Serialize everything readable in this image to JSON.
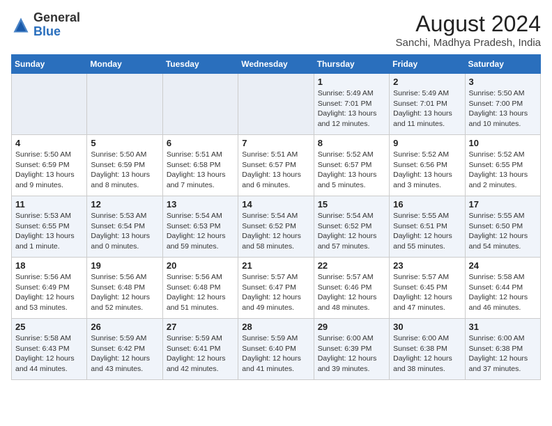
{
  "header": {
    "logo_general": "General",
    "logo_blue": "Blue",
    "month_year": "August 2024",
    "location": "Sanchi, Madhya Pradesh, India"
  },
  "weekdays": [
    "Sunday",
    "Monday",
    "Tuesday",
    "Wednesday",
    "Thursday",
    "Friday",
    "Saturday"
  ],
  "weeks": [
    [
      {
        "day": "",
        "info": ""
      },
      {
        "day": "",
        "info": ""
      },
      {
        "day": "",
        "info": ""
      },
      {
        "day": "",
        "info": ""
      },
      {
        "day": "1",
        "info": "Sunrise: 5:49 AM\nSunset: 7:01 PM\nDaylight: 13 hours\nand 12 minutes."
      },
      {
        "day": "2",
        "info": "Sunrise: 5:49 AM\nSunset: 7:01 PM\nDaylight: 13 hours\nand 11 minutes."
      },
      {
        "day": "3",
        "info": "Sunrise: 5:50 AM\nSunset: 7:00 PM\nDaylight: 13 hours\nand 10 minutes."
      }
    ],
    [
      {
        "day": "4",
        "info": "Sunrise: 5:50 AM\nSunset: 6:59 PM\nDaylight: 13 hours\nand 9 minutes."
      },
      {
        "day": "5",
        "info": "Sunrise: 5:50 AM\nSunset: 6:59 PM\nDaylight: 13 hours\nand 8 minutes."
      },
      {
        "day": "6",
        "info": "Sunrise: 5:51 AM\nSunset: 6:58 PM\nDaylight: 13 hours\nand 7 minutes."
      },
      {
        "day": "7",
        "info": "Sunrise: 5:51 AM\nSunset: 6:57 PM\nDaylight: 13 hours\nand 6 minutes."
      },
      {
        "day": "8",
        "info": "Sunrise: 5:52 AM\nSunset: 6:57 PM\nDaylight: 13 hours\nand 5 minutes."
      },
      {
        "day": "9",
        "info": "Sunrise: 5:52 AM\nSunset: 6:56 PM\nDaylight: 13 hours\nand 3 minutes."
      },
      {
        "day": "10",
        "info": "Sunrise: 5:52 AM\nSunset: 6:55 PM\nDaylight: 13 hours\nand 2 minutes."
      }
    ],
    [
      {
        "day": "11",
        "info": "Sunrise: 5:53 AM\nSunset: 6:55 PM\nDaylight: 13 hours\nand 1 minute."
      },
      {
        "day": "12",
        "info": "Sunrise: 5:53 AM\nSunset: 6:54 PM\nDaylight: 13 hours\nand 0 minutes."
      },
      {
        "day": "13",
        "info": "Sunrise: 5:54 AM\nSunset: 6:53 PM\nDaylight: 12 hours\nand 59 minutes."
      },
      {
        "day": "14",
        "info": "Sunrise: 5:54 AM\nSunset: 6:52 PM\nDaylight: 12 hours\nand 58 minutes."
      },
      {
        "day": "15",
        "info": "Sunrise: 5:54 AM\nSunset: 6:52 PM\nDaylight: 12 hours\nand 57 minutes."
      },
      {
        "day": "16",
        "info": "Sunrise: 5:55 AM\nSunset: 6:51 PM\nDaylight: 12 hours\nand 55 minutes."
      },
      {
        "day": "17",
        "info": "Sunrise: 5:55 AM\nSunset: 6:50 PM\nDaylight: 12 hours\nand 54 minutes."
      }
    ],
    [
      {
        "day": "18",
        "info": "Sunrise: 5:56 AM\nSunset: 6:49 PM\nDaylight: 12 hours\nand 53 minutes."
      },
      {
        "day": "19",
        "info": "Sunrise: 5:56 AM\nSunset: 6:48 PM\nDaylight: 12 hours\nand 52 minutes."
      },
      {
        "day": "20",
        "info": "Sunrise: 5:56 AM\nSunset: 6:48 PM\nDaylight: 12 hours\nand 51 minutes."
      },
      {
        "day": "21",
        "info": "Sunrise: 5:57 AM\nSunset: 6:47 PM\nDaylight: 12 hours\nand 49 minutes."
      },
      {
        "day": "22",
        "info": "Sunrise: 5:57 AM\nSunset: 6:46 PM\nDaylight: 12 hours\nand 48 minutes."
      },
      {
        "day": "23",
        "info": "Sunrise: 5:57 AM\nSunset: 6:45 PM\nDaylight: 12 hours\nand 47 minutes."
      },
      {
        "day": "24",
        "info": "Sunrise: 5:58 AM\nSunset: 6:44 PM\nDaylight: 12 hours\nand 46 minutes."
      }
    ],
    [
      {
        "day": "25",
        "info": "Sunrise: 5:58 AM\nSunset: 6:43 PM\nDaylight: 12 hours\nand 44 minutes."
      },
      {
        "day": "26",
        "info": "Sunrise: 5:59 AM\nSunset: 6:42 PM\nDaylight: 12 hours\nand 43 minutes."
      },
      {
        "day": "27",
        "info": "Sunrise: 5:59 AM\nSunset: 6:41 PM\nDaylight: 12 hours\nand 42 minutes."
      },
      {
        "day": "28",
        "info": "Sunrise: 5:59 AM\nSunset: 6:40 PM\nDaylight: 12 hours\nand 41 minutes."
      },
      {
        "day": "29",
        "info": "Sunrise: 6:00 AM\nSunset: 6:39 PM\nDaylight: 12 hours\nand 39 minutes."
      },
      {
        "day": "30",
        "info": "Sunrise: 6:00 AM\nSunset: 6:38 PM\nDaylight: 12 hours\nand 38 minutes."
      },
      {
        "day": "31",
        "info": "Sunrise: 6:00 AM\nSunset: 6:38 PM\nDaylight: 12 hours\nand 37 minutes."
      }
    ]
  ]
}
